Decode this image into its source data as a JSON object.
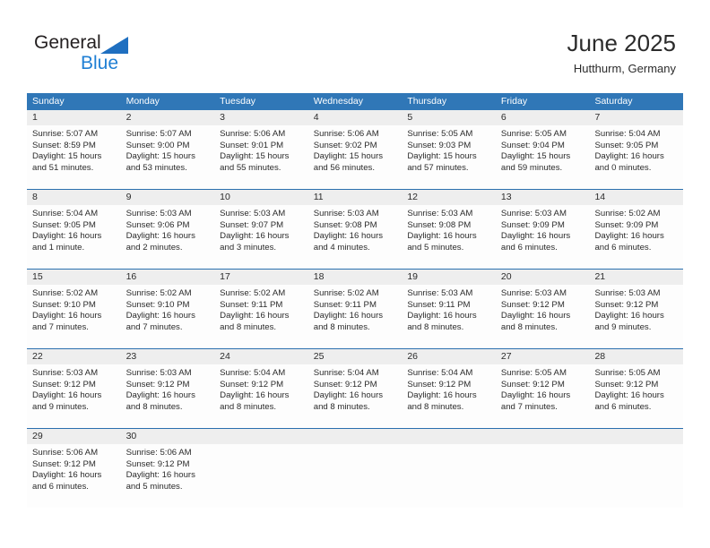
{
  "logo": {
    "word_top": "General",
    "word_bottom": "Blue",
    "triangle_color": "#1f6fc0",
    "blue_color": "#1f7fd4"
  },
  "header": {
    "title": "June 2025",
    "location": "Hutthurm, Germany"
  },
  "theme": {
    "header_blue": "#3077b7",
    "separator_blue": "#2a6fae",
    "day_band_gray": "#eeeeee",
    "text": "#2b2b2b"
  },
  "weekdays": [
    "Sunday",
    "Monday",
    "Tuesday",
    "Wednesday",
    "Thursday",
    "Friday",
    "Saturday"
  ],
  "weeks": [
    {
      "days": [
        {
          "num": "1",
          "sunrise": "Sunrise: 5:07 AM",
          "sunset": "Sunset: 8:59 PM",
          "daylight_1": "Daylight: 15 hours",
          "daylight_2": "and 51 minutes."
        },
        {
          "num": "2",
          "sunrise": "Sunrise: 5:07 AM",
          "sunset": "Sunset: 9:00 PM",
          "daylight_1": "Daylight: 15 hours",
          "daylight_2": "and 53 minutes."
        },
        {
          "num": "3",
          "sunrise": "Sunrise: 5:06 AM",
          "sunset": "Sunset: 9:01 PM",
          "daylight_1": "Daylight: 15 hours",
          "daylight_2": "and 55 minutes."
        },
        {
          "num": "4",
          "sunrise": "Sunrise: 5:06 AM",
          "sunset": "Sunset: 9:02 PM",
          "daylight_1": "Daylight: 15 hours",
          "daylight_2": "and 56 minutes."
        },
        {
          "num": "5",
          "sunrise": "Sunrise: 5:05 AM",
          "sunset": "Sunset: 9:03 PM",
          "daylight_1": "Daylight: 15 hours",
          "daylight_2": "and 57 minutes."
        },
        {
          "num": "6",
          "sunrise": "Sunrise: 5:05 AM",
          "sunset": "Sunset: 9:04 PM",
          "daylight_1": "Daylight: 15 hours",
          "daylight_2": "and 59 minutes."
        },
        {
          "num": "7",
          "sunrise": "Sunrise: 5:04 AM",
          "sunset": "Sunset: 9:05 PM",
          "daylight_1": "Daylight: 16 hours",
          "daylight_2": "and 0 minutes."
        }
      ]
    },
    {
      "days": [
        {
          "num": "8",
          "sunrise": "Sunrise: 5:04 AM",
          "sunset": "Sunset: 9:05 PM",
          "daylight_1": "Daylight: 16 hours",
          "daylight_2": "and 1 minute."
        },
        {
          "num": "9",
          "sunrise": "Sunrise: 5:03 AM",
          "sunset": "Sunset: 9:06 PM",
          "daylight_1": "Daylight: 16 hours",
          "daylight_2": "and 2 minutes."
        },
        {
          "num": "10",
          "sunrise": "Sunrise: 5:03 AM",
          "sunset": "Sunset: 9:07 PM",
          "daylight_1": "Daylight: 16 hours",
          "daylight_2": "and 3 minutes."
        },
        {
          "num": "11",
          "sunrise": "Sunrise: 5:03 AM",
          "sunset": "Sunset: 9:08 PM",
          "daylight_1": "Daylight: 16 hours",
          "daylight_2": "and 4 minutes."
        },
        {
          "num": "12",
          "sunrise": "Sunrise: 5:03 AM",
          "sunset": "Sunset: 9:08 PM",
          "daylight_1": "Daylight: 16 hours",
          "daylight_2": "and 5 minutes."
        },
        {
          "num": "13",
          "sunrise": "Sunrise: 5:03 AM",
          "sunset": "Sunset: 9:09 PM",
          "daylight_1": "Daylight: 16 hours",
          "daylight_2": "and 6 minutes."
        },
        {
          "num": "14",
          "sunrise": "Sunrise: 5:02 AM",
          "sunset": "Sunset: 9:09 PM",
          "daylight_1": "Daylight: 16 hours",
          "daylight_2": "and 6 minutes."
        }
      ]
    },
    {
      "days": [
        {
          "num": "15",
          "sunrise": "Sunrise: 5:02 AM",
          "sunset": "Sunset: 9:10 PM",
          "daylight_1": "Daylight: 16 hours",
          "daylight_2": "and 7 minutes."
        },
        {
          "num": "16",
          "sunrise": "Sunrise: 5:02 AM",
          "sunset": "Sunset: 9:10 PM",
          "daylight_1": "Daylight: 16 hours",
          "daylight_2": "and 7 minutes."
        },
        {
          "num": "17",
          "sunrise": "Sunrise: 5:02 AM",
          "sunset": "Sunset: 9:11 PM",
          "daylight_1": "Daylight: 16 hours",
          "daylight_2": "and 8 minutes."
        },
        {
          "num": "18",
          "sunrise": "Sunrise: 5:02 AM",
          "sunset": "Sunset: 9:11 PM",
          "daylight_1": "Daylight: 16 hours",
          "daylight_2": "and 8 minutes."
        },
        {
          "num": "19",
          "sunrise": "Sunrise: 5:03 AM",
          "sunset": "Sunset: 9:11 PM",
          "daylight_1": "Daylight: 16 hours",
          "daylight_2": "and 8 minutes."
        },
        {
          "num": "20",
          "sunrise": "Sunrise: 5:03 AM",
          "sunset": "Sunset: 9:12 PM",
          "daylight_1": "Daylight: 16 hours",
          "daylight_2": "and 8 minutes."
        },
        {
          "num": "21",
          "sunrise": "Sunrise: 5:03 AM",
          "sunset": "Sunset: 9:12 PM",
          "daylight_1": "Daylight: 16 hours",
          "daylight_2": "and 9 minutes."
        }
      ]
    },
    {
      "days": [
        {
          "num": "22",
          "sunrise": "Sunrise: 5:03 AM",
          "sunset": "Sunset: 9:12 PM",
          "daylight_1": "Daylight: 16 hours",
          "daylight_2": "and 9 minutes."
        },
        {
          "num": "23",
          "sunrise": "Sunrise: 5:03 AM",
          "sunset": "Sunset: 9:12 PM",
          "daylight_1": "Daylight: 16 hours",
          "daylight_2": "and 8 minutes."
        },
        {
          "num": "24",
          "sunrise": "Sunrise: 5:04 AM",
          "sunset": "Sunset: 9:12 PM",
          "daylight_1": "Daylight: 16 hours",
          "daylight_2": "and 8 minutes."
        },
        {
          "num": "25",
          "sunrise": "Sunrise: 5:04 AM",
          "sunset": "Sunset: 9:12 PM",
          "daylight_1": "Daylight: 16 hours",
          "daylight_2": "and 8 minutes."
        },
        {
          "num": "26",
          "sunrise": "Sunrise: 5:04 AM",
          "sunset": "Sunset: 9:12 PM",
          "daylight_1": "Daylight: 16 hours",
          "daylight_2": "and 8 minutes."
        },
        {
          "num": "27",
          "sunrise": "Sunrise: 5:05 AM",
          "sunset": "Sunset: 9:12 PM",
          "daylight_1": "Daylight: 16 hours",
          "daylight_2": "and 7 minutes."
        },
        {
          "num": "28",
          "sunrise": "Sunrise: 5:05 AM",
          "sunset": "Sunset: 9:12 PM",
          "daylight_1": "Daylight: 16 hours",
          "daylight_2": "and 6 minutes."
        }
      ]
    },
    {
      "days": [
        {
          "num": "29",
          "sunrise": "Sunrise: 5:06 AM",
          "sunset": "Sunset: 9:12 PM",
          "daylight_1": "Daylight: 16 hours",
          "daylight_2": "and 6 minutes."
        },
        {
          "num": "30",
          "sunrise": "Sunrise: 5:06 AM",
          "sunset": "Sunset: 9:12 PM",
          "daylight_1": "Daylight: 16 hours",
          "daylight_2": "and 5 minutes."
        },
        {
          "num": "",
          "sunrise": "",
          "sunset": "",
          "daylight_1": "",
          "daylight_2": ""
        },
        {
          "num": "",
          "sunrise": "",
          "sunset": "",
          "daylight_1": "",
          "daylight_2": ""
        },
        {
          "num": "",
          "sunrise": "",
          "sunset": "",
          "daylight_1": "",
          "daylight_2": ""
        },
        {
          "num": "",
          "sunrise": "",
          "sunset": "",
          "daylight_1": "",
          "daylight_2": ""
        },
        {
          "num": "",
          "sunrise": "",
          "sunset": "",
          "daylight_1": "",
          "daylight_2": ""
        }
      ]
    }
  ]
}
